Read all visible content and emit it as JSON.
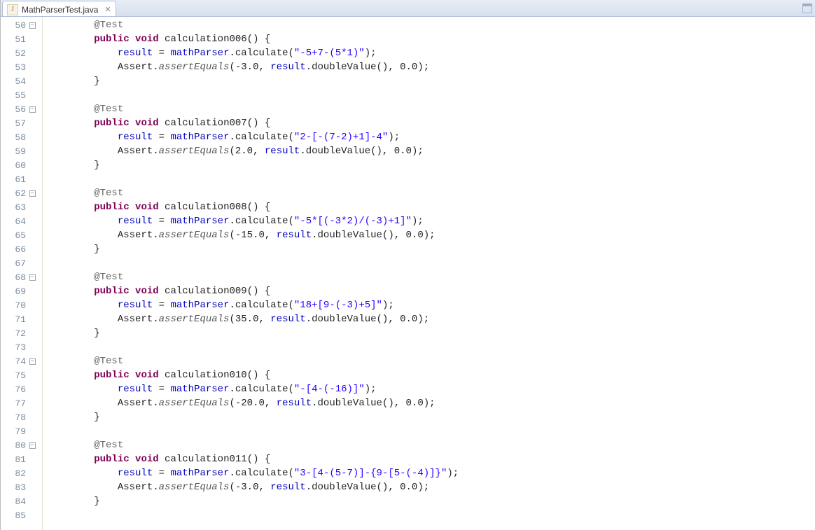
{
  "tab": {
    "filename": "MathParserTest.java",
    "icon_letter": "J",
    "close_glyph": "✕"
  },
  "lines": [
    {
      "num": "50",
      "fold": "minus",
      "tokens": [
        {
          "cls": "txt",
          "t": "        "
        },
        {
          "cls": "ann",
          "t": "@Test"
        }
      ]
    },
    {
      "num": "51",
      "fold": "",
      "tokens": [
        {
          "cls": "txt",
          "t": "        "
        },
        {
          "cls": "kw",
          "t": "public"
        },
        {
          "cls": "txt",
          "t": " "
        },
        {
          "cls": "kw",
          "t": "void"
        },
        {
          "cls": "txt",
          "t": " calculation006() {"
        }
      ]
    },
    {
      "num": "52",
      "fold": "",
      "tokens": [
        {
          "cls": "txt",
          "t": "            "
        },
        {
          "cls": "fld",
          "t": "result"
        },
        {
          "cls": "txt",
          "t": " = "
        },
        {
          "cls": "fld",
          "t": "mathParser"
        },
        {
          "cls": "txt",
          "t": ".calculate("
        },
        {
          "cls": "str",
          "t": "\"-5+7-(5*1)\""
        },
        {
          "cls": "txt",
          "t": ");"
        }
      ]
    },
    {
      "num": "53",
      "fold": "",
      "tokens": [
        {
          "cls": "txt",
          "t": "            Assert."
        },
        {
          "cls": "mth",
          "t": "assertEquals"
        },
        {
          "cls": "txt",
          "t": "(-3.0, "
        },
        {
          "cls": "fld",
          "t": "result"
        },
        {
          "cls": "txt",
          "t": ".doubleValue(), 0.0);"
        }
      ]
    },
    {
      "num": "54",
      "fold": "",
      "tokens": [
        {
          "cls": "txt",
          "t": "        }"
        }
      ]
    },
    {
      "num": "55",
      "fold": "",
      "tokens": [
        {
          "cls": "txt",
          "t": " "
        }
      ]
    },
    {
      "num": "56",
      "fold": "minus",
      "tokens": [
        {
          "cls": "txt",
          "t": "        "
        },
        {
          "cls": "ann",
          "t": "@Test"
        }
      ]
    },
    {
      "num": "57",
      "fold": "",
      "tokens": [
        {
          "cls": "txt",
          "t": "        "
        },
        {
          "cls": "kw",
          "t": "public"
        },
        {
          "cls": "txt",
          "t": " "
        },
        {
          "cls": "kw",
          "t": "void"
        },
        {
          "cls": "txt",
          "t": " calculation007() {"
        }
      ]
    },
    {
      "num": "58",
      "fold": "",
      "tokens": [
        {
          "cls": "txt",
          "t": "            "
        },
        {
          "cls": "fld",
          "t": "result"
        },
        {
          "cls": "txt",
          "t": " = "
        },
        {
          "cls": "fld",
          "t": "mathParser"
        },
        {
          "cls": "txt",
          "t": ".calculate("
        },
        {
          "cls": "str",
          "t": "\"2-[-(7-2)+1]-4\""
        },
        {
          "cls": "txt",
          "t": ");"
        }
      ]
    },
    {
      "num": "59",
      "fold": "",
      "tokens": [
        {
          "cls": "txt",
          "t": "            Assert."
        },
        {
          "cls": "mth",
          "t": "assertEquals"
        },
        {
          "cls": "txt",
          "t": "(2.0, "
        },
        {
          "cls": "fld",
          "t": "result"
        },
        {
          "cls": "txt",
          "t": ".doubleValue(), 0.0);"
        }
      ]
    },
    {
      "num": "60",
      "fold": "",
      "tokens": [
        {
          "cls": "txt",
          "t": "        }"
        }
      ]
    },
    {
      "num": "61",
      "fold": "",
      "tokens": [
        {
          "cls": "txt",
          "t": " "
        }
      ]
    },
    {
      "num": "62",
      "fold": "minus",
      "tokens": [
        {
          "cls": "txt",
          "t": "        "
        },
        {
          "cls": "ann",
          "t": "@Test"
        }
      ]
    },
    {
      "num": "63",
      "fold": "",
      "tokens": [
        {
          "cls": "txt",
          "t": "        "
        },
        {
          "cls": "kw",
          "t": "public"
        },
        {
          "cls": "txt",
          "t": " "
        },
        {
          "cls": "kw",
          "t": "void"
        },
        {
          "cls": "txt",
          "t": " calculation008() {"
        }
      ]
    },
    {
      "num": "64",
      "fold": "",
      "tokens": [
        {
          "cls": "txt",
          "t": "            "
        },
        {
          "cls": "fld",
          "t": "result"
        },
        {
          "cls": "txt",
          "t": " = "
        },
        {
          "cls": "fld",
          "t": "mathParser"
        },
        {
          "cls": "txt",
          "t": ".calculate("
        },
        {
          "cls": "str",
          "t": "\"-5*[(-3*2)/(-3)+1]\""
        },
        {
          "cls": "txt",
          "t": ");"
        }
      ]
    },
    {
      "num": "65",
      "fold": "",
      "tokens": [
        {
          "cls": "txt",
          "t": "            Assert."
        },
        {
          "cls": "mth",
          "t": "assertEquals"
        },
        {
          "cls": "txt",
          "t": "(-15.0, "
        },
        {
          "cls": "fld",
          "t": "result"
        },
        {
          "cls": "txt",
          "t": ".doubleValue(), 0.0);"
        }
      ]
    },
    {
      "num": "66",
      "fold": "",
      "tokens": [
        {
          "cls": "txt",
          "t": "        }"
        }
      ]
    },
    {
      "num": "67",
      "fold": "",
      "tokens": [
        {
          "cls": "txt",
          "t": " "
        }
      ]
    },
    {
      "num": "68",
      "fold": "minus",
      "tokens": [
        {
          "cls": "txt",
          "t": "        "
        },
        {
          "cls": "ann",
          "t": "@Test"
        }
      ]
    },
    {
      "num": "69",
      "fold": "",
      "tokens": [
        {
          "cls": "txt",
          "t": "        "
        },
        {
          "cls": "kw",
          "t": "public"
        },
        {
          "cls": "txt",
          "t": " "
        },
        {
          "cls": "kw",
          "t": "void"
        },
        {
          "cls": "txt",
          "t": " calculation009() {"
        }
      ]
    },
    {
      "num": "70",
      "fold": "",
      "tokens": [
        {
          "cls": "txt",
          "t": "            "
        },
        {
          "cls": "fld",
          "t": "result"
        },
        {
          "cls": "txt",
          "t": " = "
        },
        {
          "cls": "fld",
          "t": "mathParser"
        },
        {
          "cls": "txt",
          "t": ".calculate("
        },
        {
          "cls": "str",
          "t": "\"18+[9-(-3)+5]\""
        },
        {
          "cls": "txt",
          "t": ");"
        }
      ]
    },
    {
      "num": "71",
      "fold": "",
      "tokens": [
        {
          "cls": "txt",
          "t": "            Assert."
        },
        {
          "cls": "mth",
          "t": "assertEquals"
        },
        {
          "cls": "txt",
          "t": "(35.0, "
        },
        {
          "cls": "fld",
          "t": "result"
        },
        {
          "cls": "txt",
          "t": ".doubleValue(), 0.0);"
        }
      ]
    },
    {
      "num": "72",
      "fold": "",
      "tokens": [
        {
          "cls": "txt",
          "t": "        }"
        }
      ]
    },
    {
      "num": "73",
      "fold": "",
      "tokens": [
        {
          "cls": "txt",
          "t": " "
        }
      ]
    },
    {
      "num": "74",
      "fold": "minus",
      "tokens": [
        {
          "cls": "txt",
          "t": "        "
        },
        {
          "cls": "ann",
          "t": "@Test"
        }
      ]
    },
    {
      "num": "75",
      "fold": "",
      "tokens": [
        {
          "cls": "txt",
          "t": "        "
        },
        {
          "cls": "kw",
          "t": "public"
        },
        {
          "cls": "txt",
          "t": " "
        },
        {
          "cls": "kw",
          "t": "void"
        },
        {
          "cls": "txt",
          "t": " calculation010() {"
        }
      ]
    },
    {
      "num": "76",
      "fold": "",
      "tokens": [
        {
          "cls": "txt",
          "t": "            "
        },
        {
          "cls": "fld",
          "t": "result"
        },
        {
          "cls": "txt",
          "t": " = "
        },
        {
          "cls": "fld",
          "t": "mathParser"
        },
        {
          "cls": "txt",
          "t": ".calculate("
        },
        {
          "cls": "str",
          "t": "\"-[4-(-16)]\""
        },
        {
          "cls": "txt",
          "t": ");"
        }
      ]
    },
    {
      "num": "77",
      "fold": "",
      "tokens": [
        {
          "cls": "txt",
          "t": "            Assert."
        },
        {
          "cls": "mth",
          "t": "assertEquals"
        },
        {
          "cls": "txt",
          "t": "(-20.0, "
        },
        {
          "cls": "fld",
          "t": "result"
        },
        {
          "cls": "txt",
          "t": ".doubleValue(), 0.0);"
        }
      ]
    },
    {
      "num": "78",
      "fold": "",
      "tokens": [
        {
          "cls": "txt",
          "t": "        }"
        }
      ]
    },
    {
      "num": "79",
      "fold": "",
      "tokens": [
        {
          "cls": "txt",
          "t": " "
        }
      ]
    },
    {
      "num": "80",
      "fold": "minus",
      "tokens": [
        {
          "cls": "txt",
          "t": "        "
        },
        {
          "cls": "ann",
          "t": "@Test"
        }
      ]
    },
    {
      "num": "81",
      "fold": "",
      "tokens": [
        {
          "cls": "txt",
          "t": "        "
        },
        {
          "cls": "kw",
          "t": "public"
        },
        {
          "cls": "txt",
          "t": " "
        },
        {
          "cls": "kw",
          "t": "void"
        },
        {
          "cls": "txt",
          "t": " calculation011() {"
        }
      ]
    },
    {
      "num": "82",
      "fold": "",
      "tokens": [
        {
          "cls": "txt",
          "t": "            "
        },
        {
          "cls": "fld",
          "t": "result"
        },
        {
          "cls": "txt",
          "t": " = "
        },
        {
          "cls": "fld",
          "t": "mathParser"
        },
        {
          "cls": "txt",
          "t": ".calculate("
        },
        {
          "cls": "str",
          "t": "\"3-[4-(5-7)]-{9-[5-(-4)]}\""
        },
        {
          "cls": "txt",
          "t": ");"
        }
      ]
    },
    {
      "num": "83",
      "fold": "",
      "tokens": [
        {
          "cls": "txt",
          "t": "            Assert."
        },
        {
          "cls": "mth",
          "t": "assertEquals"
        },
        {
          "cls": "txt",
          "t": "(-3.0, "
        },
        {
          "cls": "fld",
          "t": "result"
        },
        {
          "cls": "txt",
          "t": ".doubleValue(), 0.0);"
        }
      ]
    },
    {
      "num": "84",
      "fold": "",
      "tokens": [
        {
          "cls": "txt",
          "t": "        }"
        }
      ]
    },
    {
      "num": "85",
      "fold": "",
      "tokens": [
        {
          "cls": "txt",
          "t": " "
        }
      ]
    }
  ]
}
